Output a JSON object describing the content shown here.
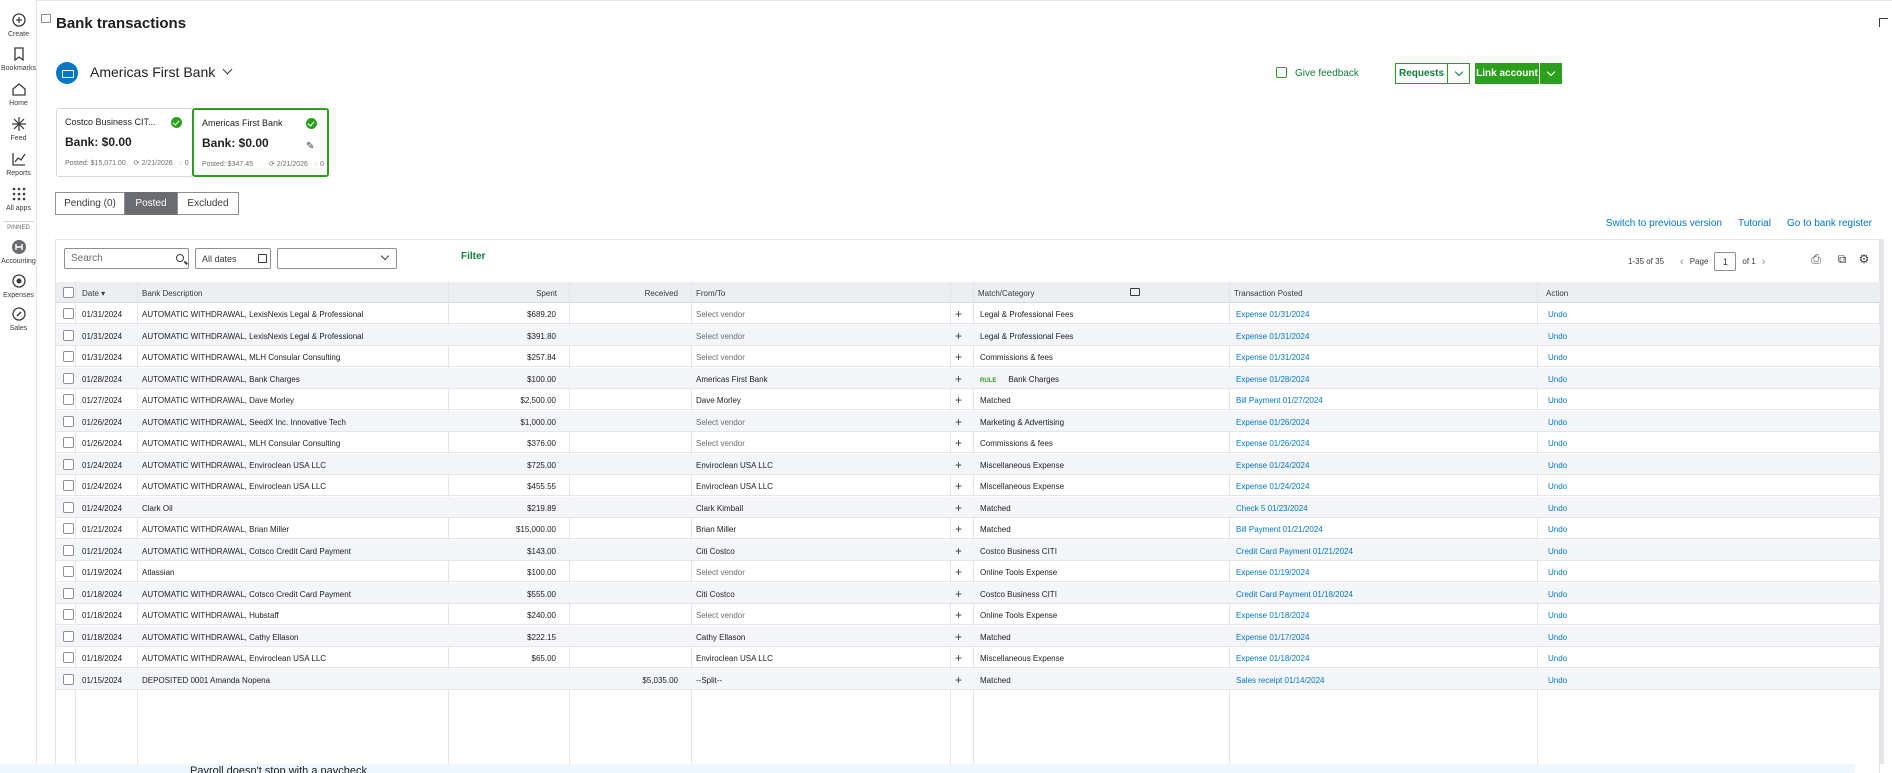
{
  "left_rail": {
    "items": [
      {
        "label": "Create",
        "icon": "plus-circle-icon"
      },
      {
        "label": "Bookmarks",
        "icon": "bookmark-icon"
      },
      {
        "label": "Home",
        "icon": "home-icon"
      },
      {
        "label": "Feed",
        "icon": "sparkle-icon"
      },
      {
        "label": "Reports",
        "icon": "chart-icon"
      },
      {
        "label": "All apps",
        "icon": "grid-icon"
      }
    ],
    "pinned_label": "PINNED",
    "pinned_items": [
      {
        "label": "Accounting",
        "icon": "accounting-icon"
      },
      {
        "label": "Expenses",
        "icon": "expenses-icon"
      },
      {
        "label": "Sales",
        "icon": "sales-icon"
      }
    ]
  },
  "header": {
    "title": "Bank transactions",
    "bank_name": "Americas First Bank",
    "give_feedback": "Give feedback",
    "requests": "Requests",
    "link_account": "Link account"
  },
  "accounts": [
    {
      "name": "Costco Business CIT...",
      "bank": "Bank: $0.00",
      "posted": "Posted: $15,071.00",
      "date": "2/21/2026",
      "count": "0"
    },
    {
      "name": "Americas First Bank",
      "bank": "Bank: $0.00",
      "posted": "Posted: $347.45",
      "date": "2/21/2026",
      "count": "0"
    }
  ],
  "tabs": {
    "pending": "Pending (0)",
    "posted": "Posted",
    "excluded": "Excluded"
  },
  "top_links": {
    "switch": "Switch to previous version",
    "tutorial": "Tutorial",
    "register": "Go to bank register"
  },
  "toolbar": {
    "search_placeholder": "Search",
    "date_filter": "All dates",
    "filter": "Filter",
    "range": "1-35 of 35",
    "page_label": "Page",
    "page_value": "1",
    "of_label": "of 1"
  },
  "columns": {
    "date": "Date",
    "description": "Bank Description",
    "spent": "Spent",
    "received": "Received",
    "from_to": "From/To",
    "match": "Match/Category",
    "posted": "Transaction Posted",
    "action": "Action"
  },
  "rows": [
    {
      "date": "01/31/2024",
      "desc": "AUTOMATIC WITHDRAWAL, LexisNexis Legal & Professional",
      "spent": "$689.20",
      "received": "",
      "from": "Select vendor",
      "placeholder": true,
      "rule": "",
      "match": "Legal & Professional Fees",
      "posted": "Expense 01/31/2024",
      "action": "Undo"
    },
    {
      "date": "01/31/2024",
      "desc": "AUTOMATIC WITHDRAWAL, LexisNexis Legal & Professional",
      "spent": "$391.80",
      "received": "",
      "from": "Select vendor",
      "placeholder": true,
      "rule": "",
      "match": "Legal & Professional Fees",
      "posted": "Expense 01/31/2024",
      "action": "Undo"
    },
    {
      "date": "01/31/2024",
      "desc": "AUTOMATIC WITHDRAWAL, MLH Consular Consulting",
      "spent": "$257.84",
      "received": "",
      "from": "Select vendor",
      "placeholder": true,
      "rule": "",
      "match": "Commissions & fees",
      "posted": "Expense 01/31/2024",
      "action": "Undo"
    },
    {
      "date": "01/28/2024",
      "desc": "AUTOMATIC WITHDRAWAL, Bank Charges",
      "spent": "$100.00",
      "received": "",
      "from": "Americas First Bank",
      "placeholder": false,
      "rule": "RULE",
      "match": "Bank Charges",
      "posted": "Expense 01/28/2024",
      "action": "Undo"
    },
    {
      "date": "01/27/2024",
      "desc": "AUTOMATIC WITHDRAWAL, Dave Morley",
      "spent": "$2,500.00",
      "received": "",
      "from": "Dave Morley",
      "placeholder": false,
      "rule": "",
      "match": "Matched",
      "posted": "Bill Payment 01/27/2024",
      "action": "Undo"
    },
    {
      "date": "01/26/2024",
      "desc": "AUTOMATIC WITHDRAWAL, SeedX Inc. Innovative Tech",
      "spent": "$1,000.00",
      "received": "",
      "from": "Select vendor",
      "placeholder": true,
      "rule": "",
      "match": "Marketing & Advertising",
      "posted": "Expense 01/26/2024",
      "action": "Undo"
    },
    {
      "date": "01/26/2024",
      "desc": "AUTOMATIC WITHDRAWAL, MLH Consular Consulting",
      "spent": "$376.00",
      "received": "",
      "from": "Select vendor",
      "placeholder": true,
      "rule": "",
      "match": "Commissions & fees",
      "posted": "Expense 01/26/2024",
      "action": "Undo"
    },
    {
      "date": "01/24/2024",
      "desc": "AUTOMATIC WITHDRAWAL, Enviroclean USA LLC",
      "spent": "$725.00",
      "received": "",
      "from": "Enviroclean USA LLC",
      "placeholder": false,
      "rule": "",
      "match": "Miscellaneous Expense",
      "posted": "Expense 01/24/2024",
      "action": "Undo"
    },
    {
      "date": "01/24/2024",
      "desc": "AUTOMATIC WITHDRAWAL, Enviroclean USA LLC",
      "spent": "$455.55",
      "received": "",
      "from": "Enviroclean USA LLC",
      "placeholder": false,
      "rule": "",
      "match": "Miscellaneous Expense",
      "posted": "Expense 01/24/2024",
      "action": "Undo"
    },
    {
      "date": "01/24/2024",
      "desc": "Clark Oil",
      "spent": "$219.89",
      "received": "",
      "from": "Clark Kimball",
      "placeholder": false,
      "rule": "",
      "match": "Matched",
      "posted": "Check 5 01/23/2024",
      "action": "Undo"
    },
    {
      "date": "01/21/2024",
      "desc": "AUTOMATIC WITHDRAWAL, Brian Miller",
      "spent": "$15,000.00",
      "received": "",
      "from": "Brian Miller",
      "placeholder": false,
      "rule": "",
      "match": "Matched",
      "posted": "Bill Payment 01/21/2024",
      "action": "Undo"
    },
    {
      "date": "01/21/2024",
      "desc": "AUTOMATIC WITHDRAWAL, Cotsco Credit Card Payment",
      "spent": "$143.00",
      "received": "",
      "from": "Citi Costco",
      "placeholder": false,
      "rule": "",
      "match": "Costco Business CITI",
      "posted": "Credit Card Payment 01/21/2024",
      "action": "Undo"
    },
    {
      "date": "01/19/2024",
      "desc": "Atlassian",
      "spent": "$100.00",
      "received": "",
      "from": "Select vendor",
      "placeholder": true,
      "rule": "",
      "match": "Online Tools Expense",
      "posted": "Expense 01/19/2024",
      "action": "Undo"
    },
    {
      "date": "01/18/2024",
      "desc": "AUTOMATIC WITHDRAWAL, Cotsco Credit Card Payment",
      "spent": "$555.00",
      "received": "",
      "from": "Citi Costco",
      "placeholder": false,
      "rule": "",
      "match": "Costco Business CITI",
      "posted": "Credit Card Payment 01/18/2024",
      "action": "Undo"
    },
    {
      "date": "01/18/2024",
      "desc": "AUTOMATIC WITHDRAWAL, Hubstaff",
      "spent": "$240.00",
      "received": "",
      "from": "Select vendor",
      "placeholder": true,
      "rule": "",
      "match": "Online Tools Expense",
      "posted": "Expense 01/18/2024",
      "action": "Undo"
    },
    {
      "date": "01/18/2024",
      "desc": "AUTOMATIC WITHDRAWAL, Cathy Ellason",
      "spent": "$222.15",
      "received": "",
      "from": "Cathy Ellason",
      "placeholder": false,
      "rule": "",
      "match": "Matched",
      "posted": "Expense 01/17/2024",
      "action": "Undo"
    },
    {
      "date": "01/18/2024",
      "desc": "AUTOMATIC WITHDRAWAL, Enviroclean USA LLC",
      "spent": "$65.00",
      "received": "",
      "from": "Enviroclean USA LLC",
      "placeholder": false,
      "rule": "",
      "match": "Miscellaneous Expense",
      "posted": "Expense 01/18/2024",
      "action": "Undo"
    },
    {
      "date": "01/15/2024",
      "desc": "DEPOSITED 0001 Amanda Nopena",
      "spent": "",
      "received": "$5,035.00",
      "from": "--Split--",
      "placeholder": false,
      "rule": "",
      "match": "Matched",
      "posted": "Sales receipt 01/14/2024",
      "action": "Undo"
    }
  ],
  "banner": {
    "text": "Payroll doesn't stop with a paycheck"
  }
}
